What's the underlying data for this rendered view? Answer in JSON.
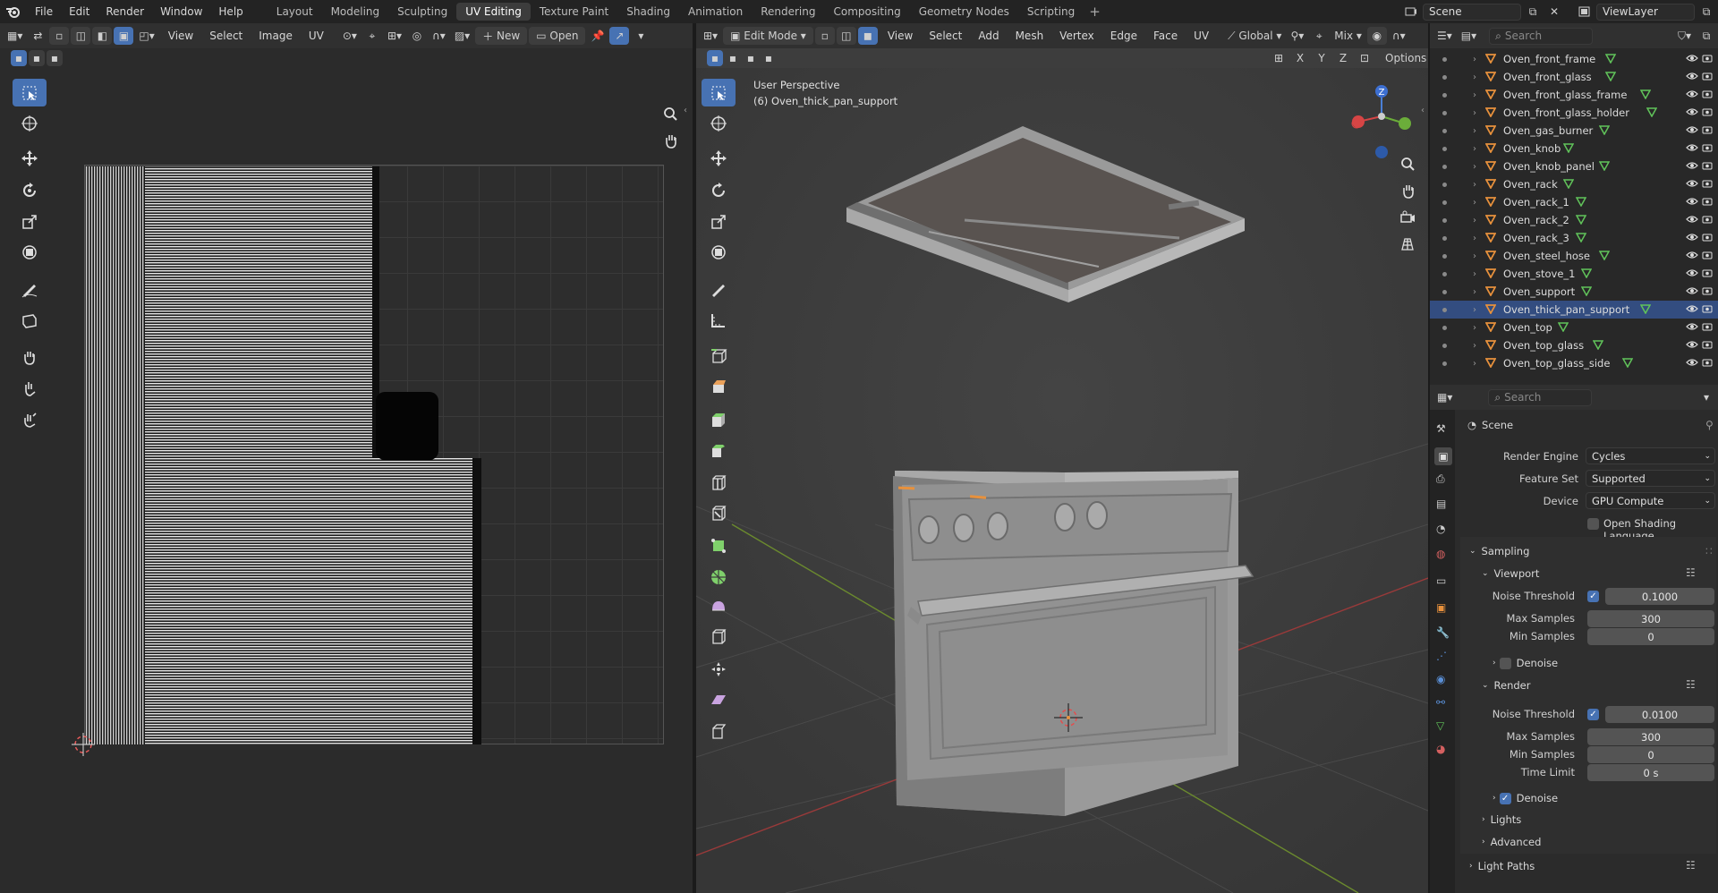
{
  "menu": {
    "file": "File",
    "edit": "Edit",
    "render": "Render",
    "window": "Window",
    "help": "Help"
  },
  "workspaces": [
    {
      "label": "Layout",
      "active": false
    },
    {
      "label": "Modeling",
      "active": false
    },
    {
      "label": "Sculpting",
      "active": false
    },
    {
      "label": "UV Editing",
      "active": true
    },
    {
      "label": "Texture Paint",
      "active": false
    },
    {
      "label": "Shading",
      "active": false
    },
    {
      "label": "Animation",
      "active": false
    },
    {
      "label": "Rendering",
      "active": false
    },
    {
      "label": "Compositing",
      "active": false
    },
    {
      "label": "Geometry Nodes",
      "active": false
    },
    {
      "label": "Scripting",
      "active": false
    }
  ],
  "scene_field": "Scene",
  "view_layer_field": "ViewLayer",
  "uv_editor": {
    "menus": {
      "view": "View",
      "select": "Select",
      "image": "Image",
      "uv": "UV"
    },
    "new_label": "New",
    "open_label": "Open"
  },
  "viewport": {
    "mode": "Edit Mode",
    "menus": {
      "view": "View",
      "select": "Select",
      "add": "Add",
      "mesh": "Mesh",
      "vertex": "Vertex",
      "edge": "Edge",
      "face": "Face",
      "uv": "UV"
    },
    "orientation": "Global",
    "snap_mode": "Mix",
    "axes": {
      "x": "X",
      "y": "Y",
      "z": "Z"
    },
    "options_label": "Options",
    "perspective": "User Perspective",
    "object": "(6) Oven_thick_pan_support",
    "gizmo": {
      "z": "Z"
    }
  },
  "outliner": {
    "search_placeholder": "Search",
    "items": [
      {
        "name": "Oven_front_frame",
        "selected": false
      },
      {
        "name": "Oven_front_glass",
        "selected": false
      },
      {
        "name": "Oven_front_glass_frame",
        "selected": false
      },
      {
        "name": "Oven_front_glass_holder",
        "selected": false
      },
      {
        "name": "Oven_gas_burner",
        "selected": false
      },
      {
        "name": "Oven_knob",
        "selected": false
      },
      {
        "name": "Oven_knob_panel",
        "selected": false
      },
      {
        "name": "Oven_rack",
        "selected": false
      },
      {
        "name": "Oven_rack_1",
        "selected": false
      },
      {
        "name": "Oven_rack_2",
        "selected": false
      },
      {
        "name": "Oven_rack_3",
        "selected": false
      },
      {
        "name": "Oven_steel_hose",
        "selected": false
      },
      {
        "name": "Oven_stove_1",
        "selected": false
      },
      {
        "name": "Oven_support",
        "selected": false
      },
      {
        "name": "Oven_thick_pan_support",
        "selected": true
      },
      {
        "name": "Oven_top",
        "selected": false
      },
      {
        "name": "Oven_top_glass",
        "selected": false
      },
      {
        "name": "Oven_top_glass_side",
        "selected": false
      }
    ]
  },
  "properties": {
    "search_placeholder": "Search",
    "context": "Scene",
    "render_engine_label": "Render Engine",
    "render_engine": "Cycles",
    "feature_set_label": "Feature Set",
    "feature_set": "Supported",
    "device_label": "Device",
    "device": "GPU Compute",
    "osl_label": "Open Shading Language",
    "sampling": "Sampling",
    "viewport_section": "Viewport",
    "vp_noise_label": "Noise Threshold",
    "vp_noise": "0.1000",
    "vp_max_label": "Max Samples",
    "vp_max": "300",
    "vp_min_label": "Min Samples",
    "vp_min": "0",
    "vp_denoise": "Denoise",
    "render_section": "Render",
    "r_noise_label": "Noise Threshold",
    "r_noise": "0.0100",
    "r_max_label": "Max Samples",
    "r_max": "300",
    "r_min_label": "Min Samples",
    "r_min": "0",
    "r_time_label": "Time Limit",
    "r_time": "0 s",
    "r_denoise": "Denoise",
    "lights": "Lights",
    "advanced": "Advanced",
    "light_paths": "Light Paths"
  },
  "colors": {
    "accent": "#4772b3",
    "selected_row": "#334d80",
    "object_orange": "#e8913c",
    "mesh_green": "#61c45a"
  }
}
